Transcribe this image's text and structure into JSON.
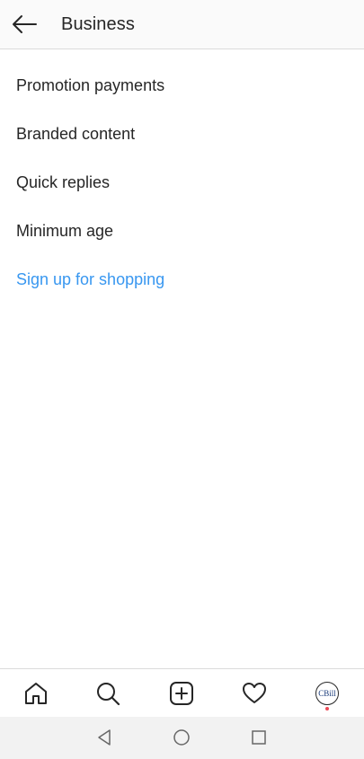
{
  "header": {
    "title": "Business",
    "back_icon": "arrow-left-icon"
  },
  "menu": {
    "items": [
      {
        "label": "Promotion payments"
      },
      {
        "label": "Branded content"
      },
      {
        "label": "Quick replies"
      },
      {
        "label": "Minimum age"
      },
      {
        "label": "Sign up for shopping"
      }
    ]
  },
  "tabbar": {
    "icons": [
      "home-icon",
      "search-icon",
      "add-post-icon",
      "heart-icon",
      "profile-avatar"
    ],
    "avatar_text": "CBill",
    "notification_color": "#ed4956"
  },
  "system_nav": {
    "icons": [
      "back-triangle-icon",
      "home-circle-icon",
      "recents-square-icon"
    ]
  },
  "colors": {
    "link": "#3897f0",
    "text": "#262626",
    "header_bg": "#fafafa",
    "divider": "#dbdbdb"
  }
}
